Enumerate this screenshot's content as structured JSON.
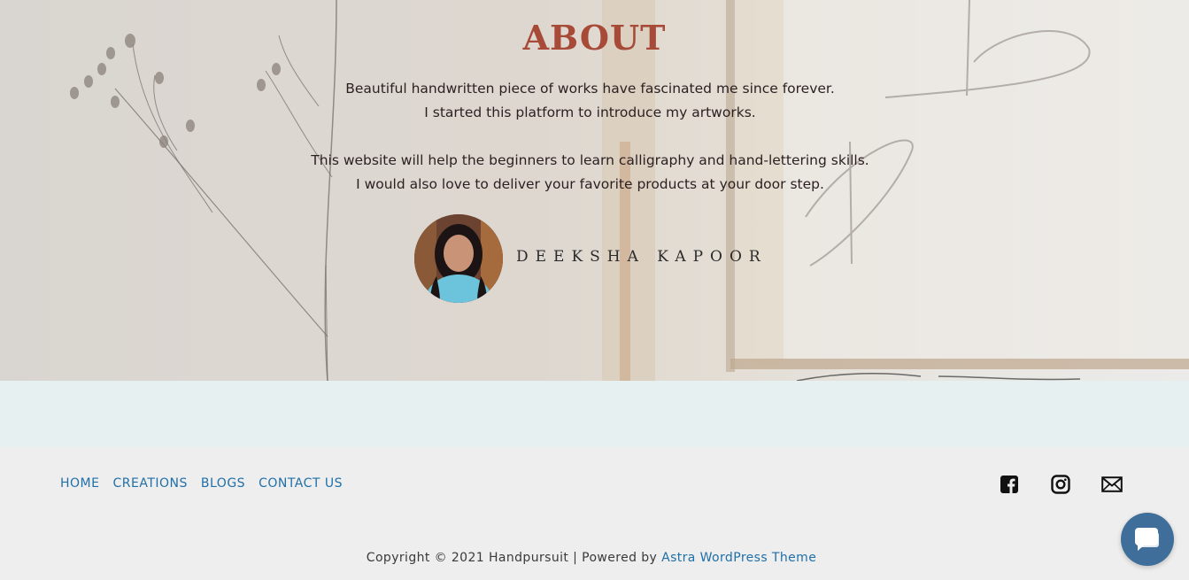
{
  "about": {
    "title": "ABOUT",
    "line1": "Beautiful handwritten piece of works have fascinated me since forever.",
    "line2": "I started this platform to introduce my artworks.",
    "line3": "This website will help the beginners to learn calligraphy and hand-lettering skills.",
    "line4": "I would also love to deliver your favorite products at your door step.",
    "author_name": "DEEKSHA KAPOOR",
    "avatar_icon": "person-photo"
  },
  "footer": {
    "nav": [
      {
        "label": "HOME"
      },
      {
        "label": "CREATIONS"
      },
      {
        "label": "BLOGS"
      },
      {
        "label": "CONTACT US"
      }
    ],
    "social_icons": [
      "facebook-icon",
      "instagram-icon",
      "email-icon"
    ],
    "copyright_prefix": "Copyright © 2021 Handpursuit | Powered by ",
    "copyright_link": "Astra WordPress Theme"
  },
  "chat": {
    "icon": "chat-icon"
  },
  "colors": {
    "title": "#a74a38",
    "link": "#1f6fa8",
    "band": "#e6f0f0",
    "footer_bg": "#eeeeee",
    "chat_bg": "#3f6e9b"
  }
}
